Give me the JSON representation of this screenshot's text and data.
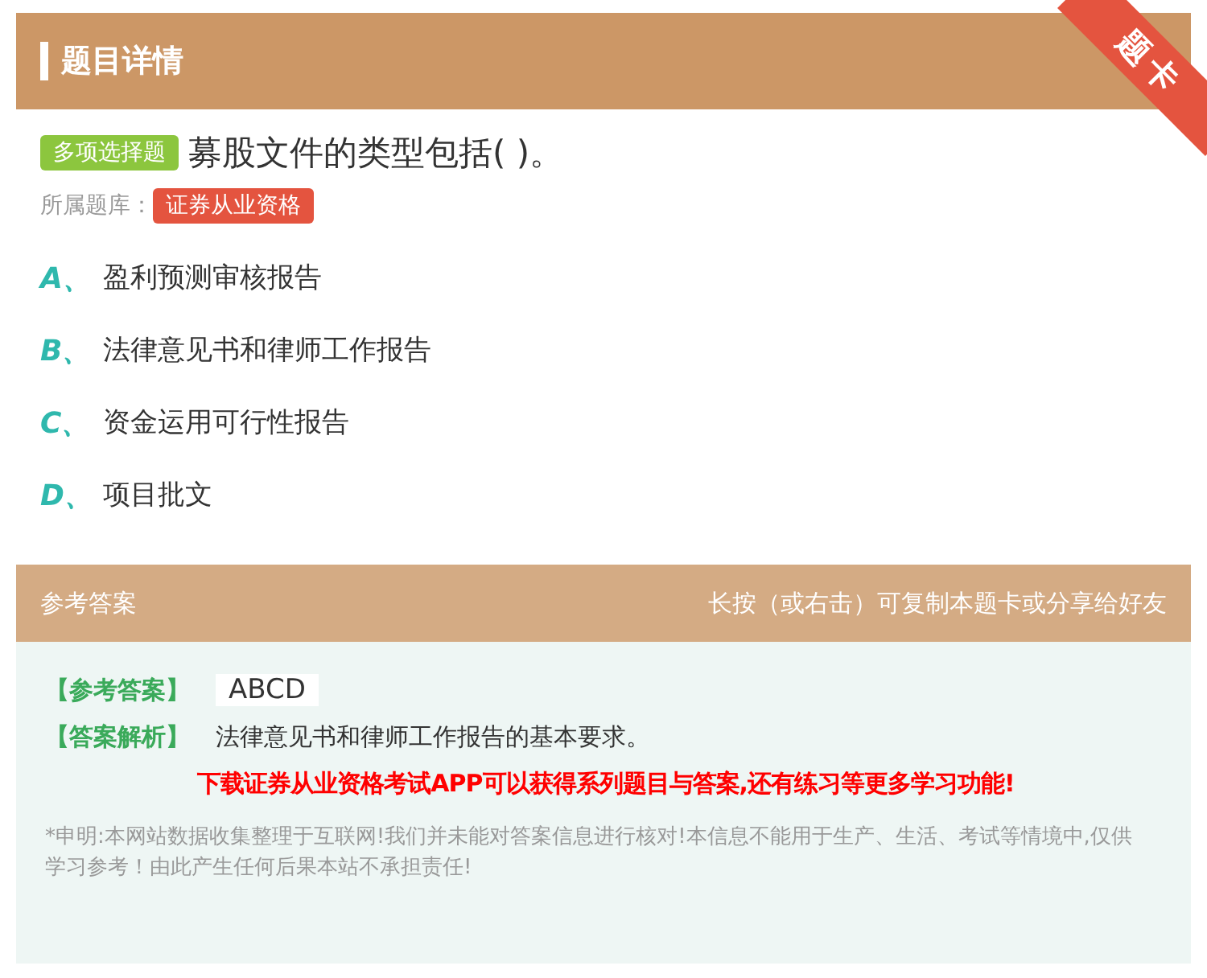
{
  "header": {
    "title": "题目详情",
    "ribbon": "题卡"
  },
  "question": {
    "type_badge": "多项选择题",
    "text": "募股文件的类型包括( )。",
    "bank_label": "所属题库：",
    "bank": "证券从业资格"
  },
  "options": [
    {
      "letter": "A、",
      "text": "盈利预测审核报告"
    },
    {
      "letter": "B、",
      "text": "法律意见书和律师工作报告"
    },
    {
      "letter": "C、",
      "text": "资金运用可行性报告"
    },
    {
      "letter": "D、",
      "text": "项目批文"
    }
  ],
  "answer_panel": {
    "title": "参考答案",
    "hint": "长按（或右击）可复制本题卡或分享给好友",
    "answer_label": "【参考答案】",
    "answer": "ABCD",
    "analysis_label": "【答案解析】",
    "analysis": "法律意见书和律师工作报告的基本要求。",
    "promo": "下载证券从业资格考试APP可以获得系列题目与答案,还有练习等更多学习功能!",
    "disclaimer": "*申明:本网站数据收集整理于互联网!我们并未能对答案信息进行核对!本信息不能用于生产、生活、考试等情境中,仅供学习参考！由此产生任何后果本站不承担责任!"
  }
}
